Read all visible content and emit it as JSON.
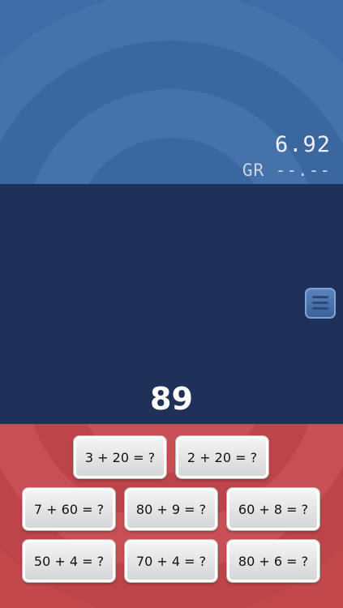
{
  "score": {
    "time": "6.92",
    "record": "GR --.--"
  },
  "target": "89",
  "menu": {
    "icon": "menu-icon"
  },
  "choices": [
    "3 + 20 = ?",
    "2 + 20 = ?",
    "7 + 60 = ?",
    "80 + 9 = ?",
    "60 + 8 = ?",
    "50 + 4 = ?",
    "70 + 4 = ?",
    "80 + 6 = ?"
  ],
  "colors": {
    "top_panel": "#3d6ca6",
    "middle_panel": "#1f3158",
    "bottom_panel": "#c2484c",
    "tile": "#e6e6e6"
  }
}
